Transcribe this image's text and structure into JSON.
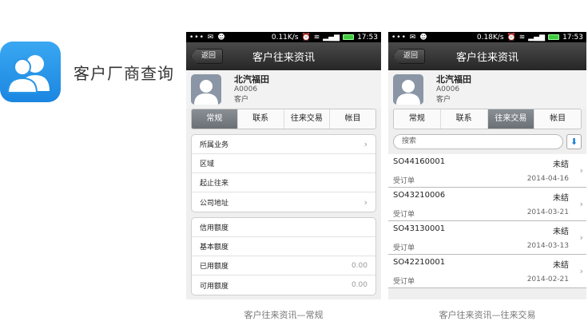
{
  "feature": {
    "title": "客户厂商查询",
    "icon": "users-icon"
  },
  "status_bar_left": "••• ✉ ☻",
  "screen1": {
    "status_speed": "0.11K/s",
    "status_time": "17:53",
    "back_label": "返回",
    "title": "客户往来资讯",
    "customer": {
      "name": "北汽福田",
      "code": "A0006",
      "type": "客户"
    },
    "tabs": [
      {
        "label": "常规",
        "active": true
      },
      {
        "label": "联系",
        "active": false
      },
      {
        "label": "往来交易",
        "active": false
      },
      {
        "label": "帐目",
        "active": false
      }
    ],
    "group1": [
      {
        "label": "所属业务",
        "chevron": true,
        "value": ""
      },
      {
        "label": "区域",
        "chevron": false,
        "value": ""
      },
      {
        "label": "起止往来",
        "chevron": false,
        "value": ""
      },
      {
        "label": "公司地址",
        "chevron": true,
        "value": ""
      }
    ],
    "group2": [
      {
        "label": "信用额度",
        "value": ""
      },
      {
        "label": "基本额度",
        "value": ""
      },
      {
        "label": "已用额度",
        "value": "0.00"
      },
      {
        "label": "可用额度",
        "value": "0.00"
      }
    ],
    "caption": "客户往来资讯—常规"
  },
  "screen2": {
    "status_speed": "0.18K/s",
    "status_time": "17:53",
    "back_label": "返回",
    "title": "客户往来资讯",
    "customer": {
      "name": "北汽福田",
      "code": "A0006",
      "type": "客户"
    },
    "tabs": [
      {
        "label": "常规",
        "active": false
      },
      {
        "label": "联系",
        "active": false
      },
      {
        "label": "往来交易",
        "active": true
      },
      {
        "label": "帐目",
        "active": false
      }
    ],
    "search_placeholder": "搜索",
    "orders": [
      {
        "id": "SO44160001",
        "status": "未结",
        "type": "受订单",
        "date": "2014-04-16"
      },
      {
        "id": "SO43210006",
        "status": "未结",
        "type": "受订单",
        "date": "2014-03-21"
      },
      {
        "id": "SO43130001",
        "status": "未结",
        "type": "受订单",
        "date": "2014-03-13"
      },
      {
        "id": "SO42210001",
        "status": "未结",
        "type": "受订单",
        "date": "2014-02-21"
      }
    ],
    "caption": "客户往来资讯—往来交易"
  },
  "colors": {
    "accent": "#1b86e0",
    "active_tab": "#787d83",
    "titlebar": "#333333"
  }
}
